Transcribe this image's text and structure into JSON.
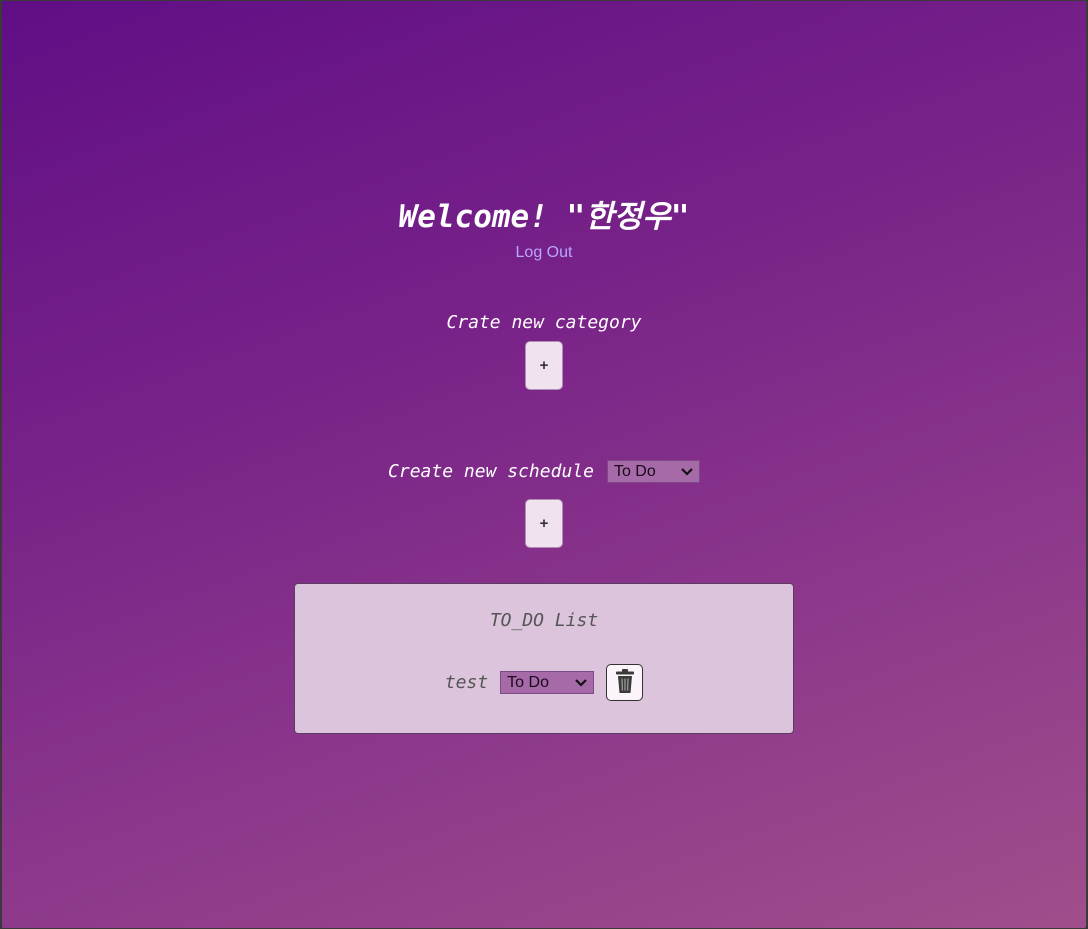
{
  "header": {
    "welcome": "Welcome! \"한정우\"",
    "logout_label": "Log Out"
  },
  "category": {
    "label": "Crate new category",
    "add_label": "+"
  },
  "schedule": {
    "label": "Create new schedule",
    "selected_category": "To Do",
    "add_label": "+"
  },
  "list": {
    "title": "TO_DO List",
    "items": [
      {
        "name": "test",
        "status": "To Do"
      }
    ]
  },
  "colors": {
    "gradient_start": "#600e85",
    "gradient_end": "#a04e8b",
    "link": "#b9a7ff",
    "panel": "#dcc4dc",
    "select": "#a66aa8"
  },
  "icons": {
    "delete": "trash-icon",
    "dropdown": "chevron-down-icon"
  }
}
